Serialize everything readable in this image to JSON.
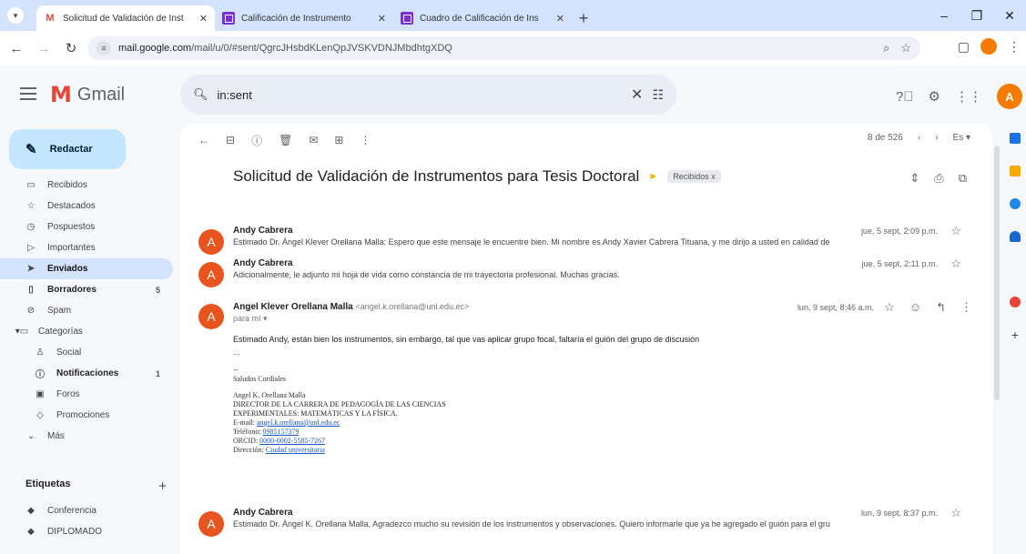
{
  "browser": {
    "tabs": [
      {
        "title": "Solicitud de Validación de Inst",
        "favicon": "gmail-icon",
        "active": true
      },
      {
        "title": "Calificación de Instrumento",
        "favicon": "doc-icon",
        "active": false
      },
      {
        "title": "Cuadro de Calificación de Ins",
        "favicon": "doc-icon",
        "active": false
      }
    ],
    "url_host": "mail.google.com",
    "url_path": "/mail/u/0/#sent/QgrcJHsbdKLenQpJVSKVDNJMbdhtgXDQ"
  },
  "gmail": {
    "logo_text": "Gmail",
    "search_value": "in:sent",
    "avatar_letter": "A",
    "compose_label": "Redactar",
    "nav": [
      {
        "label": "Recibidos",
        "icon": "inbox-icon",
        "count": ""
      },
      {
        "label": "Destacados",
        "icon": "star-icon",
        "count": ""
      },
      {
        "label": "Pospuestos",
        "icon": "clock-icon",
        "count": ""
      },
      {
        "label": "Importantes",
        "icon": "important-icon",
        "count": ""
      },
      {
        "label": "Enviados",
        "icon": "send-icon",
        "count": ""
      },
      {
        "label": "Borradores",
        "icon": "draft-icon",
        "count": "5"
      },
      {
        "label": "Spam",
        "icon": "spam-icon",
        "count": ""
      },
      {
        "label": "Categorías",
        "icon": "category-icon",
        "count": ""
      },
      {
        "label": "Social",
        "icon": "social-icon",
        "count": ""
      },
      {
        "label": "Notificaciones",
        "icon": "info-icon",
        "count": "1"
      },
      {
        "label": "Foros",
        "icon": "forum-icon",
        "count": ""
      },
      {
        "label": "Promociones",
        "icon": "tag-icon",
        "count": ""
      },
      {
        "label": "Más",
        "icon": "chevron-down-icon",
        "count": ""
      }
    ],
    "labels_title": "Etiquetas",
    "labels": [
      "Conferencia",
      "DIPLOMADO"
    ]
  },
  "thread": {
    "pager": "8 de 526",
    "subject": "Solicitud de Validación de Instrumentos para Tesis Doctoral",
    "chip": "Recibidos x",
    "messages": [
      {
        "sender": "Andy Cabrera",
        "address": "",
        "snippet": "Estimado Dr. Ángel Klever Orellana Malla: Espero que este mensaje le encuentre bien. Mi nombre es Andy Xavier Cabrera Tituana, y me dirijo a usted en calidad de",
        "date": "jue, 5 sept, 2:09 p.m."
      },
      {
        "sender": "Andy Cabrera",
        "address": "",
        "snippet": "Adicionalmente, le adjunto mi hoja de vida como constancia de mi trayectoria profesional. Muchas gracias.",
        "date": "jue, 5 sept, 2:11 p.m."
      },
      {
        "sender": "Angel Klever Orellana Malla",
        "address": "<angel.k.orellana@unl.edu.ec>",
        "to_line": "para mí",
        "date": "lun, 9 sept, 8:46 a.m.",
        "body": "Estimado Andy, están bien los instrumentos, sin embargo, tal que vas aplicar grupo focal, faltaría el guión del grupo de discusión",
        "quote": "...",
        "sig_dash": "--",
        "sig_greeting": "Saludos Cordiales",
        "sig_name": "Angel K. Orellana Malla",
        "sig_title1": "DIRECTOR DE LA CARRERA DE PEDAGOGÍA DE LAS CIENCIAS",
        "sig_title2": "EXPERIMENTALES: MATEMÁTICAS Y LA FÍSICA.",
        "sig_email_label": "E-mail:",
        "sig_email": "angel.k.orellana@unl.edu.ec",
        "sig_phone_label": "Teléfono:",
        "sig_phone": "0985157379",
        "sig_orcid_label": "ORCID:",
        "sig_orcid": "0000-0002-5585-7267",
        "sig_address_label": "Dirección:",
        "sig_address": "Ciudad universitaria"
      },
      {
        "sender": "Andy Cabrera",
        "address": "",
        "snippet": "Estimado Dr. Ángel K. Orellana Malla, Agradezco mucho su revisión de los instrumentos y observaciones. Quiero informarle que ya he agregado el guión para el gru",
        "date": "lun, 9 sept, 8:37 p.m."
      }
    ]
  },
  "colors": {
    "accent": "#0b57d0",
    "avatar": "#e8541e",
    "active_nav": "#d3e3fd",
    "compose": "#c2e7ff"
  }
}
